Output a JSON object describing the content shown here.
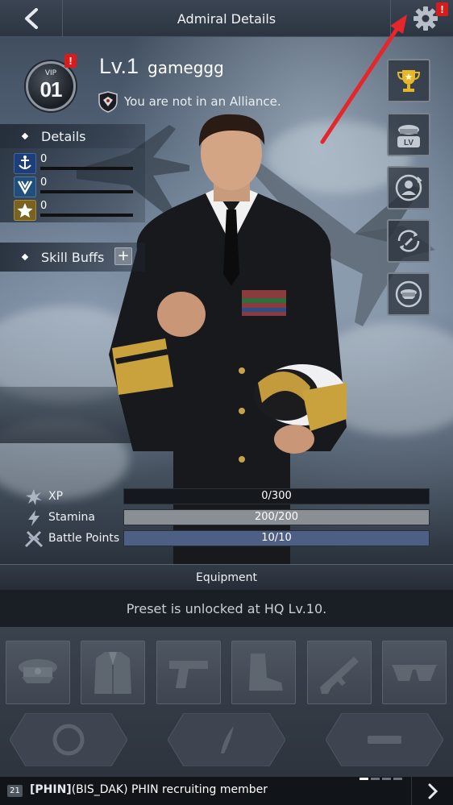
{
  "header": {
    "title": "Admiral Details"
  },
  "profile": {
    "vip_label": "VIP",
    "vip_level": "01",
    "level": "Lv.1",
    "name": "gameggg",
    "alliance_status": "You are not in an Alliance."
  },
  "details": {
    "title": "Details",
    "stats": [
      {
        "icon": "anchor-shield-icon",
        "value": "0"
      },
      {
        "icon": "chevron-shield-icon",
        "value": "0"
      },
      {
        "icon": "star-badge-icon",
        "value": "0"
      }
    ]
  },
  "skill_buffs": {
    "title": "Skill Buffs",
    "add_label": "+"
  },
  "side_buttons": [
    "trophy-icon",
    "officer-level-icon",
    "avatar-change-icon",
    "rename-rotate-icon",
    "cap-swap-icon"
  ],
  "resources": [
    {
      "name": "XP",
      "icon": "star-burst-icon",
      "text": "0/300",
      "current": 0,
      "max": 300,
      "color": "#2c3b55"
    },
    {
      "name": "Stamina",
      "icon": "lightning-icon",
      "text": "200/200",
      "current": 200,
      "max": 200,
      "color": "#8a8f96"
    },
    {
      "name": "Battle Points",
      "icon": "crossed-jets-icon",
      "text": "10/10",
      "current": 10,
      "max": 10,
      "color": "#4e5f86"
    }
  ],
  "equipment": {
    "title": "Equipment",
    "preset_message": "Preset is unlocked at HQ Lv.10.",
    "slots": [
      "officer-cap-icon",
      "uniform-jacket-icon",
      "pistol-icon",
      "combat-boot-icon",
      "rifle-icon",
      "sunglasses-icon"
    ],
    "hex_slots": [
      "ring-icon",
      "feather-icon",
      "bar-icon"
    ]
  },
  "chat": {
    "badge": "21",
    "tag": "[PHIN]",
    "message": "(BIS_DAK) PHIN recruiting member"
  },
  "alerts": {
    "badge": "!"
  }
}
